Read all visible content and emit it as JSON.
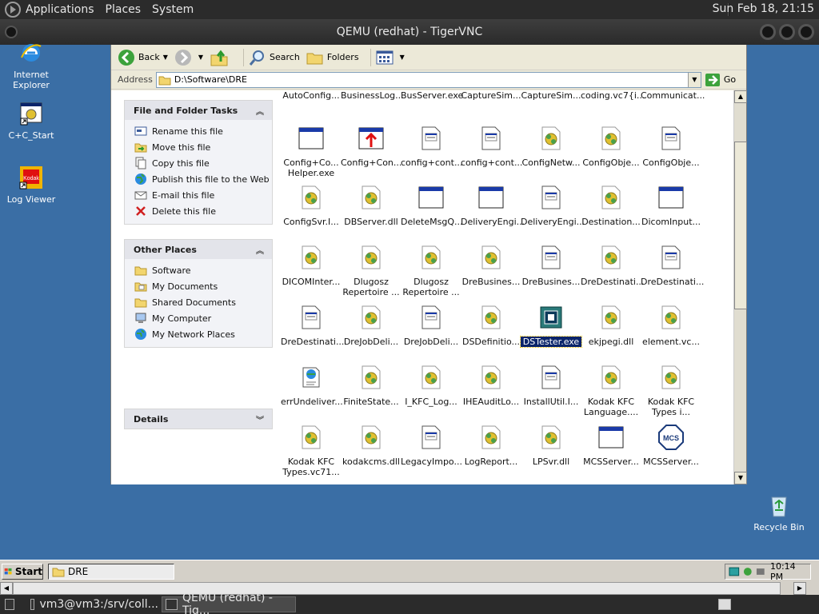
{
  "gnome_top": {
    "menus": [
      "Applications",
      "Places",
      "System"
    ],
    "clock": "Sun Feb 18, 21:15"
  },
  "vnc": {
    "title": "QEMU (redhat) - TigerVNC"
  },
  "desktop_icons": [
    "Internet\nExplorer",
    "C+C_Start",
    "Log Viewer",
    "Recycle Bin"
  ],
  "toolbar": {
    "back": "Back",
    "search": "Search",
    "folders": "Folders"
  },
  "address": {
    "label": "Address",
    "value": "D:\\Software\\DRE",
    "go": "Go"
  },
  "tasks_panel": {
    "title": "File and Folder Tasks",
    "items": [
      "Rename this file",
      "Move this file",
      "Copy this file",
      "Publish this file to the Web",
      "E-mail this file",
      "Delete this file"
    ]
  },
  "places_panel": {
    "title": "Other Places",
    "items": [
      "Software",
      "My Documents",
      "Shared Documents",
      "My Computer",
      "My Network Places"
    ]
  },
  "details_panel": {
    "title": "Details"
  },
  "files": [
    {
      "label": "AutoConfig...",
      "icon": "none"
    },
    {
      "label": "BusinessLog...",
      "icon": "none"
    },
    {
      "label": "BusServer.exe",
      "icon": "none"
    },
    {
      "label": "CaptureSim...",
      "icon": "none"
    },
    {
      "label": "CaptureSim...",
      "icon": "none"
    },
    {
      "label": "coding.vc7{i...",
      "icon": "none"
    },
    {
      "label": "Communicat...",
      "icon": "none"
    },
    {
      "label": "Config+Co...\nHelper.exe",
      "icon": "window"
    },
    {
      "label": "Config+Con...",
      "icon": "uparrow"
    },
    {
      "label": "config+cont...",
      "icon": "doc"
    },
    {
      "label": "config+cont...",
      "icon": "doc"
    },
    {
      "label": "ConfigNetw...",
      "icon": "gear"
    },
    {
      "label": "ConfigObje...",
      "icon": "gear"
    },
    {
      "label": "ConfigObje...",
      "icon": "doc"
    },
    {
      "label": "ConfigSvr.I...",
      "icon": "gear"
    },
    {
      "label": "DBServer.dll",
      "icon": "gear"
    },
    {
      "label": "DeleteMsgQ...",
      "icon": "window"
    },
    {
      "label": "DeliveryEngi...",
      "icon": "window"
    },
    {
      "label": "DeliveryEngi...",
      "icon": "doc"
    },
    {
      "label": "Destination...",
      "icon": "gear"
    },
    {
      "label": "DicomInput...",
      "icon": "window"
    },
    {
      "label": "DICOMInter...",
      "icon": "gear"
    },
    {
      "label": "Dlugosz\nRepertoire ...",
      "icon": "gear"
    },
    {
      "label": "Dlugosz\nRepertoire ...",
      "icon": "gear"
    },
    {
      "label": "DreBusines...",
      "icon": "gear"
    },
    {
      "label": "DreBusines...",
      "icon": "doc"
    },
    {
      "label": "DreDestinati...",
      "icon": "gear"
    },
    {
      "label": "DreDestinati...",
      "icon": "doc"
    },
    {
      "label": "DreDestinati...",
      "icon": "doc"
    },
    {
      "label": "DreJobDeli...",
      "icon": "gear"
    },
    {
      "label": "DreJobDeli...",
      "icon": "doc"
    },
    {
      "label": "DSDefinitio...",
      "icon": "gear"
    },
    {
      "label": "DSTester.exe",
      "icon": "chip"
    },
    {
      "label": "ekjpegi.dll",
      "icon": "gear"
    },
    {
      "label": "element.vc...",
      "icon": "gear"
    },
    {
      "label": "errUndeliver...",
      "icon": "webdoc"
    },
    {
      "label": "FiniteState...",
      "icon": "gear"
    },
    {
      "label": "I_KFC_Log...",
      "icon": "gear"
    },
    {
      "label": "IHEAuditLo...",
      "icon": "gear"
    },
    {
      "label": "InstallUtil.I...",
      "icon": "doc"
    },
    {
      "label": "Kodak KFC\nLanguage....",
      "icon": "gear"
    },
    {
      "label": "Kodak KFC\nTypes i...",
      "icon": "gear"
    },
    {
      "label": "Kodak KFC\nTypes.vc71...",
      "icon": "gear"
    },
    {
      "label": "kodakcms.dll",
      "icon": "gear"
    },
    {
      "label": "LegacyImpo...",
      "icon": "doc"
    },
    {
      "label": "LogReport...",
      "icon": "gear"
    },
    {
      "label": "LPSvr.dll",
      "icon": "gear"
    },
    {
      "label": "MCSServer...",
      "icon": "window"
    },
    {
      "label": "MCSServer...",
      "icon": "mcs"
    }
  ],
  "selected_file": "DSTester.exe",
  "win_taskbar": {
    "start": "Start",
    "task": "DRE",
    "time": "10:14 PM"
  },
  "gnome_bottom": {
    "tasks": [
      "vm3@vm3:/srv/coll...",
      "QEMU (redhat) - Tig..."
    ]
  },
  "colors": {
    "desktop": "#3a6ea5",
    "selection": "#0a246a",
    "panel_dark": "#2b2b2b"
  }
}
